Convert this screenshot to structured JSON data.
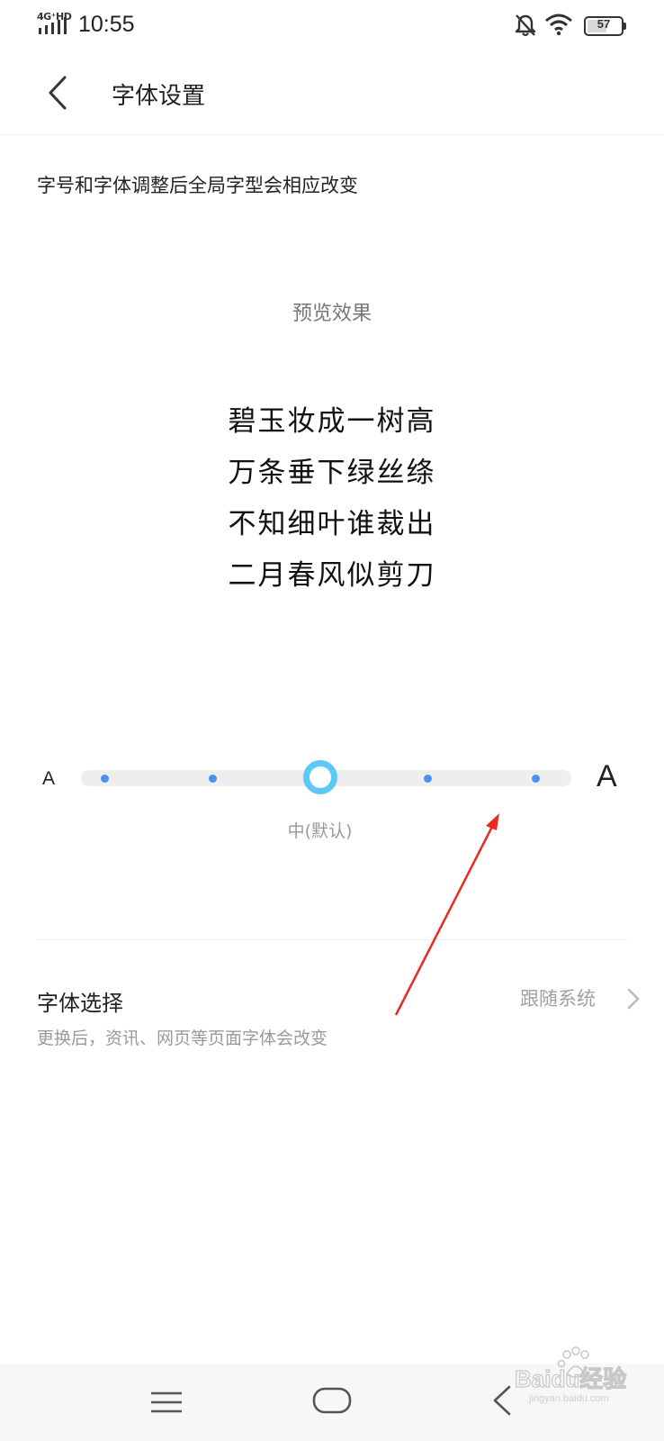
{
  "status_bar": {
    "network": "4G⁺HD",
    "time": "10:55",
    "battery": "57",
    "battery_level": 0.57
  },
  "header": {
    "title": "字体设置"
  },
  "description": "字号和字体调整后全局字型会相应改变",
  "preview": {
    "label": "预览效果",
    "lines": [
      "碧玉妆成一树高",
      "万条垂下绿丝绦",
      "不知细叶谁裁出",
      "二月春风似剪刀"
    ]
  },
  "font_size": {
    "small_label": "A",
    "large_label": "A",
    "steps": 5,
    "selected_index": 2,
    "selected_label": "中(默认)",
    "accent_color": "#5bc8f5",
    "dot_color": "#4a93f0"
  },
  "font_select": {
    "title": "字体选择",
    "subtitle": "更换后，资讯、网页等页面字体会改变",
    "value": "跟随系统"
  },
  "watermark": {
    "text": "Baidu经验",
    "url_text": "jingyan.baidu.com"
  },
  "icons": {
    "back": "chevron-left-icon",
    "bell": "bell-off-icon",
    "wifi": "wifi-icon",
    "chevron": "chevron-right-icon",
    "nav_menu": "menu-icon",
    "nav_home": "home-icon",
    "nav_back": "back-icon"
  }
}
